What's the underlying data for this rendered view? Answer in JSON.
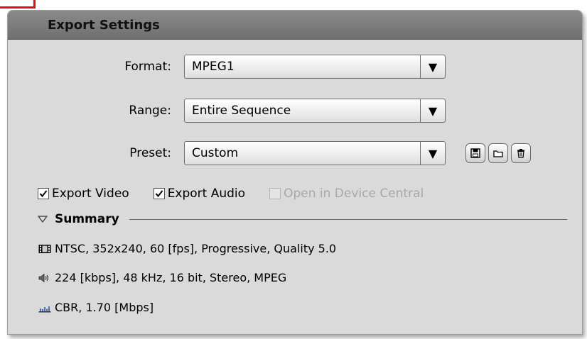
{
  "panel": {
    "title": "Export Settings"
  },
  "format": {
    "label": "Format:",
    "value": "MPEG1"
  },
  "range": {
    "label": "Range:",
    "value": "Entire Sequence"
  },
  "preset": {
    "label": "Preset:",
    "value": "Custom",
    "buttons": [
      "save-preset-icon",
      "import-preset-icon",
      "delete-preset-icon"
    ]
  },
  "checks": {
    "video": {
      "label": "Export Video",
      "checked": true
    },
    "audio": {
      "label": "Export Audio",
      "checked": true
    },
    "device": {
      "label": "Open in Device Central",
      "checked": false,
      "disabled": true
    }
  },
  "summary": {
    "title": "Summary",
    "video": "NTSC, 352x240, 60 [fps], Progressive, Quality 5.0",
    "audio": "224 [kbps], 48 kHz, 16 bit, Stereo, MPEG",
    "bitrate": "CBR, 1.70 [Mbps]"
  },
  "icons": {
    "dropdown": "dropdown-arrow-icon",
    "disclosure": "disclosure-triangle-icon"
  }
}
